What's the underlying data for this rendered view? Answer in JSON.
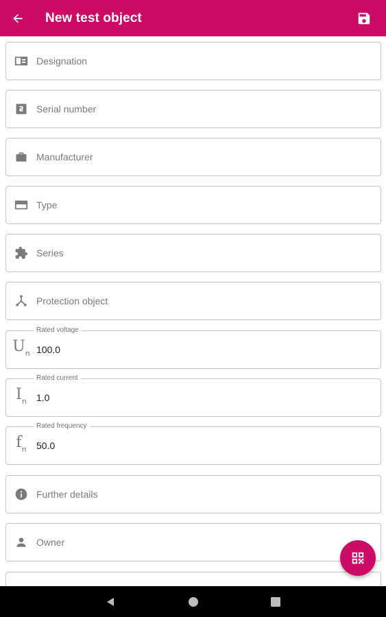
{
  "appbar": {
    "title": "New test object",
    "back_icon": "arrow-back-icon",
    "save_icon": "save-icon",
    "background": "#cc0b66"
  },
  "fields": [
    {
      "key": "designation",
      "icon": "id-card-icon",
      "placeholder": "Designation"
    },
    {
      "key": "serial_number",
      "icon": "number-box-icon",
      "placeholder": "Serial number"
    },
    {
      "key": "manufacturer",
      "icon": "factory-icon",
      "placeholder": "Manufacturer"
    },
    {
      "key": "type",
      "icon": "type-card-icon",
      "placeholder": "Type"
    },
    {
      "key": "series",
      "icon": "puzzle-icon",
      "placeholder": "Series"
    },
    {
      "key": "protection_object",
      "icon": "network-icon",
      "placeholder": "Protection object"
    },
    {
      "key": "rated_voltage",
      "icon": "voltage-symbol-icon",
      "symbol": "U",
      "symbol_sub": "n",
      "label": "Rated voltage",
      "value": "100.0"
    },
    {
      "key": "rated_current",
      "icon": "current-symbol-icon",
      "symbol": "I",
      "symbol_sub": "n",
      "label": "Rated current",
      "value": "1.0"
    },
    {
      "key": "rated_frequency",
      "icon": "frequency-symbol-icon",
      "symbol": "f",
      "symbol_sub": "n",
      "label": "Rated frequency",
      "value": "50.0"
    },
    {
      "key": "further_details",
      "icon": "info-icon",
      "placeholder": "Further details"
    },
    {
      "key": "owner",
      "icon": "person-icon",
      "placeholder": "Owner"
    }
  ],
  "fab": {
    "icon": "qr-code-icon"
  },
  "navbar": {
    "back_icon": "nav-back-icon",
    "home_icon": "nav-home-icon",
    "recents_icon": "nav-recents-icon"
  }
}
